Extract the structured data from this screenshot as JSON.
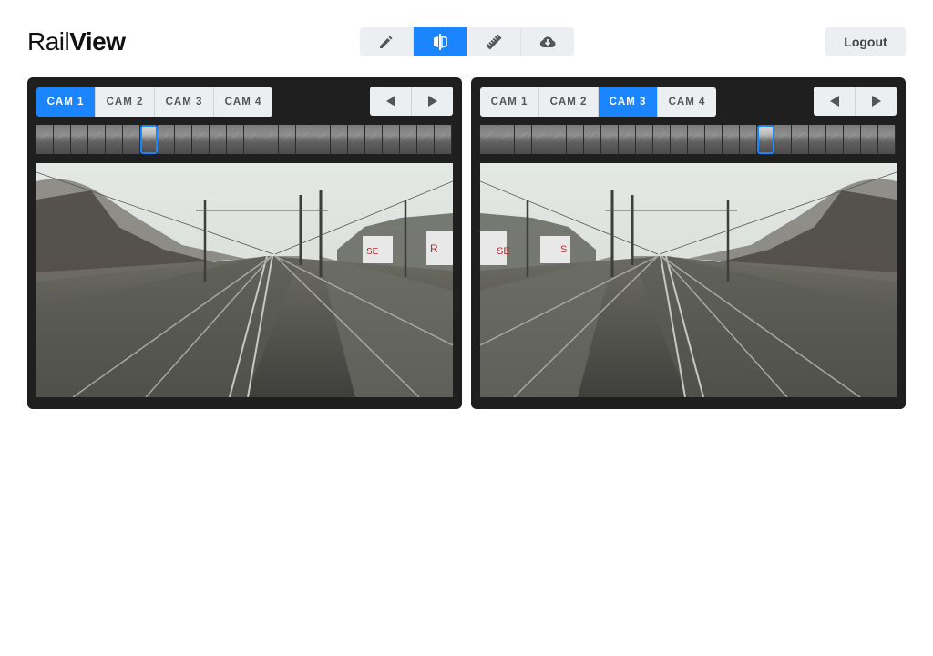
{
  "app": {
    "logo_part1": "Rail",
    "logo_part2": "View"
  },
  "toolbar": {
    "tools": [
      {
        "icon": "pencil-icon",
        "active": false
      },
      {
        "icon": "compare-icon",
        "active": true
      },
      {
        "icon": "ruler-icon",
        "active": false
      },
      {
        "icon": "cloud-download-icon",
        "active": false
      }
    ]
  },
  "logout_label": "Logout",
  "colors": {
    "accent": "#1a85ff",
    "panel": "#1f1f1f",
    "button": "#eceff2"
  },
  "panels": [
    {
      "cams": [
        "CAM 1",
        "CAM 2",
        "CAM 3",
        "CAM 4"
      ],
      "active_cam": "CAM 1",
      "frame_count": 24,
      "selected_frame": 7,
      "view": "forward"
    },
    {
      "cams": [
        "CAM 1",
        "CAM 2",
        "CAM 3",
        "CAM 4"
      ],
      "active_cam": "CAM 3",
      "frame_count": 24,
      "selected_frame": 17,
      "view": "mirrored"
    }
  ]
}
